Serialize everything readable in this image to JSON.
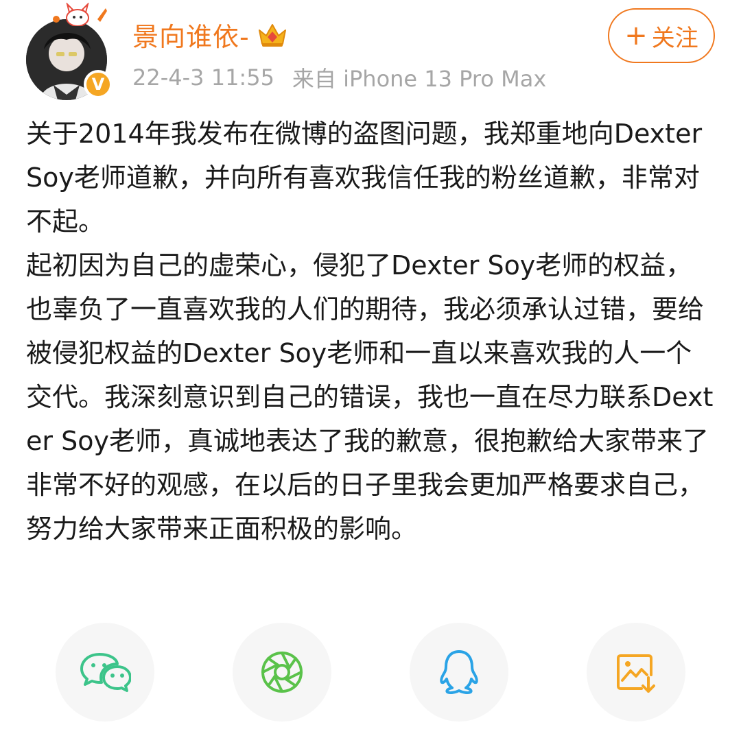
{
  "header": {
    "username": "景向谁依-",
    "timestamp": "22-4-3 11:55",
    "source": "来自 iPhone 13 Pro Max",
    "follow_plus": "+",
    "follow_label": "关注",
    "verified_mark": "V"
  },
  "post": {
    "paragraphs": [
      "关于2014年我发布在微博的盗图问题，我郑重地向Dexter Soy老师道歉，并向所有喜欢我信任我的粉丝道歉，非常对不起。",
      "起初因为自己的虚荣心，侵犯了Dexter Soy老师的权益，也辜负了一直喜欢我的人们的期待，我必须承认过错，要给被侵犯权益的Dexter Soy老师和一直以来喜欢我的人一个交代。我深刻意识到自己的错误，我也一直在尽力联系Dexter Soy老师，真诚地表达了我的歉意，很抱歉给大家带来了非常不好的观感，在以后的日子里我会更加严格要求自己，努力给大家带来正面积极的影响。"
    ]
  },
  "share": {
    "items": [
      {
        "icon": "wechat-icon",
        "color": "#3cc48a"
      },
      {
        "icon": "moments-icon",
        "color": "#5ac24a"
      },
      {
        "icon": "qq-icon",
        "color": "#2aa3e6"
      },
      {
        "icon": "save-image-icon",
        "color": "#f5a623"
      }
    ]
  },
  "colors": {
    "accent": "#f0781e",
    "meta_text": "#a6a6a6",
    "body_text": "#1a1a1a",
    "share_bg": "#f6f6f6"
  }
}
